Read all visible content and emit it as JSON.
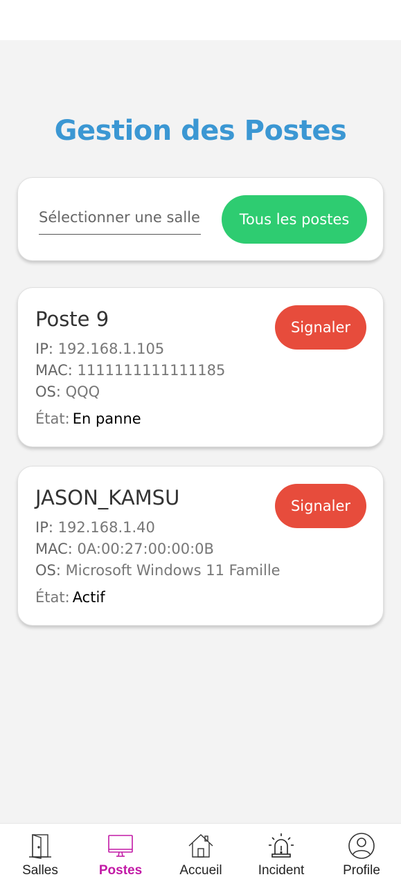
{
  "page": {
    "title": "Gestion des Postes"
  },
  "filter": {
    "select_placeholder": "Sélectionner une salle",
    "all_button": "Tous les postes"
  },
  "postes": [
    {
      "name": "Poste 9",
      "signal_label": "Signaler",
      "ip_label": "IP:",
      "ip": "192.168.1.105",
      "mac_label": "MAC:",
      "mac": "1111111111111185",
      "os_label": "OS:",
      "os": "QQQ",
      "state_label": "État:",
      "state": "En panne"
    },
    {
      "name": "JASON_KAMSU",
      "signal_label": "Signaler",
      "ip_label": "IP:",
      "ip": "192.168.1.40",
      "mac_label": "MAC:",
      "mac": "0A:00:27:00:00:0B",
      "os_label": "OS:",
      "os": "Microsoft Windows 11 Famille",
      "state_label": "État:",
      "state": "Actif"
    }
  ],
  "nav": {
    "items": [
      {
        "label": "Salles",
        "icon": "door-icon",
        "active": false
      },
      {
        "label": "Postes",
        "icon": "monitor-icon",
        "active": true
      },
      {
        "label": "Accueil",
        "icon": "home-icon",
        "active": false
      },
      {
        "label": "Incident",
        "icon": "alarm-icon",
        "active": false
      },
      {
        "label": "Profile",
        "icon": "user-icon",
        "active": false
      }
    ],
    "active_color": "#c21aa6"
  },
  "colors": {
    "title": "#3b97d3",
    "primary_button": "#2ecc71",
    "danger_button": "#e74c3c"
  }
}
